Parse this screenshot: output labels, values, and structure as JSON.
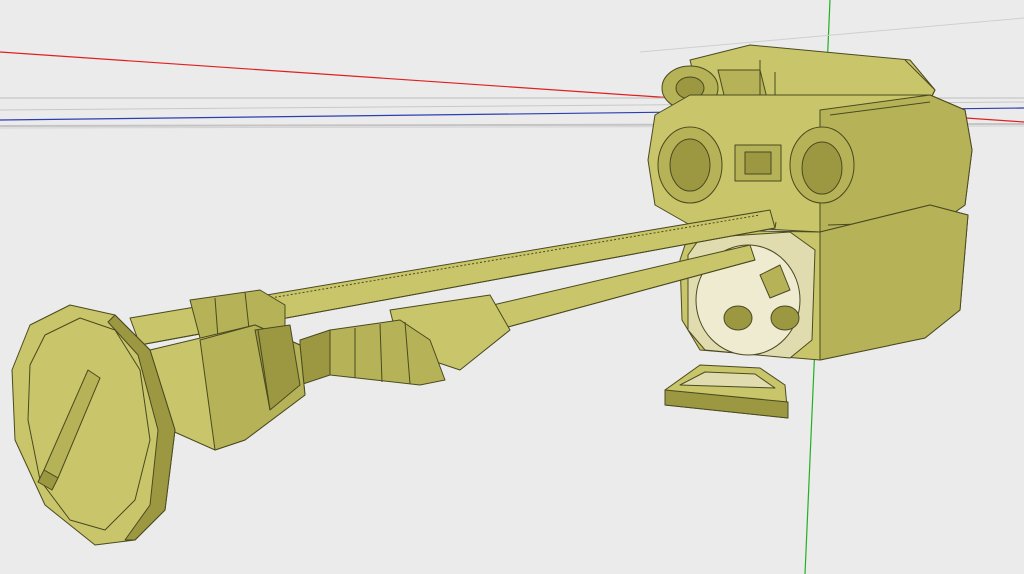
{
  "viewport": {
    "background": "#ebebeb",
    "axes": {
      "x_axis_color": "#e02020",
      "y_axis_color": "#2a3fb0",
      "z_axis_color": "#22b022",
      "guide_color": "#bdbdbd"
    }
  },
  "model": {
    "fill_light": "#c9c56a",
    "fill_mid": "#b6b258",
    "fill_dark": "#9c9842",
    "edge_color": "#4a4a20"
  }
}
